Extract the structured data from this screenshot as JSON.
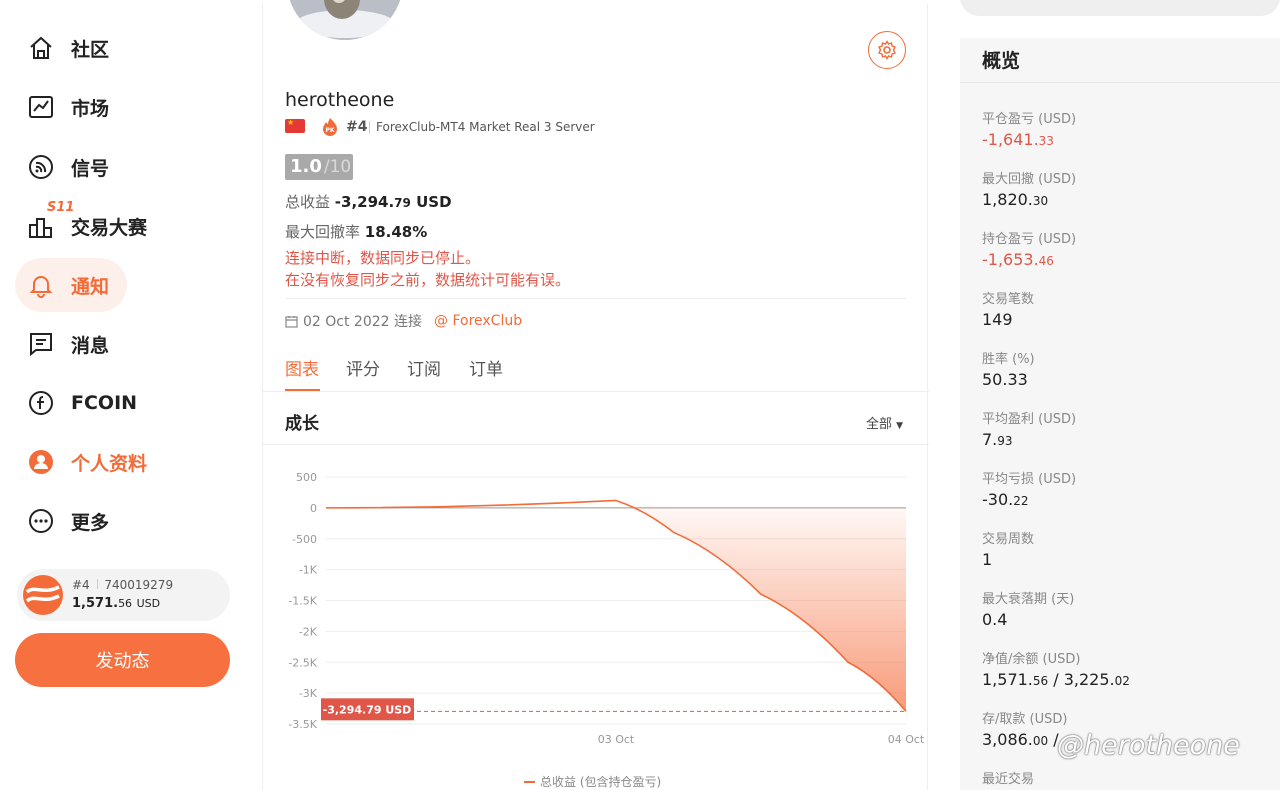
{
  "nav": {
    "items": [
      {
        "label": "社区"
      },
      {
        "label": "市场"
      },
      {
        "label": "信号"
      },
      {
        "label": "交易大赛",
        "badge": "S11"
      },
      {
        "label": "通知"
      },
      {
        "label": "消息"
      },
      {
        "label": "FCOIN"
      },
      {
        "label": "个人资料"
      },
      {
        "label": "更多"
      }
    ],
    "account": {
      "rank": "#4",
      "id": "740019279",
      "balance_int": "1,571.",
      "balance_dec": "56",
      "currency": "USD"
    },
    "post_label": "发动态"
  },
  "profile": {
    "username": "herotheone",
    "rank": "#4",
    "server": "ForexClub-MT4 Market Real 3 Server",
    "score": "1.0",
    "score_max": "/10",
    "total_profit_label": "总收益",
    "total_profit_int": "-3,294.",
    "total_profit_dec": "79",
    "total_profit_unit": "USD",
    "max_dd_label": "最大回撤率",
    "max_dd": "18.48%",
    "warning_line1": "连接中断，数据同步已停止。",
    "warning_line2": "在没有恢复同步之前，数据统计可能有误。",
    "connected_date": "02 Oct 2022 连接",
    "broker": "@ ForexClub"
  },
  "tabs": [
    "图表",
    "评分",
    "订阅",
    "订单"
  ],
  "growth": {
    "title": "成长",
    "filter": "全部"
  },
  "chart_data": {
    "type": "area",
    "ylim": [
      -3500,
      500
    ],
    "yticks": [
      "500",
      "0",
      "-500",
      "-1K",
      "-1.5K",
      "-2K",
      "-2.5K",
      "-3K",
      "-3.5K"
    ],
    "ytick_values": [
      500,
      0,
      -500,
      -1000,
      -1500,
      -2000,
      -2500,
      -3000,
      -3500
    ],
    "x_ticks": [
      "03 Oct",
      "04 Oct"
    ],
    "series": [
      {
        "name": "总收益 (包含持仓盈亏)",
        "x": [
          0,
          0.5,
          0.6,
          0.75,
          0.9,
          1.0
        ],
        "y": [
          0,
          120,
          -400,
          -1400,
          -2500,
          -3294.79
        ]
      }
    ],
    "current_label": "-3,294.79 USD",
    "current_value": -3294.79
  },
  "overview": {
    "title": "概览",
    "stats": [
      {
        "label": "平仓盈亏 (USD)",
        "int": "-1,641.",
        "dec": "33",
        "neg": true
      },
      {
        "label": "最大回撤 (USD)",
        "int": "1,820.",
        "dec": "30",
        "neg": false
      },
      {
        "label": "持仓盈亏 (USD)",
        "int": "-1,653.",
        "dec": "46",
        "neg": true
      },
      {
        "label": "交易笔数",
        "int": "149",
        "dec": "",
        "neg": false
      },
      {
        "label": "胜率 (%)",
        "int": "50.33",
        "dec": "",
        "neg": false
      },
      {
        "label": "平均盈利 (USD)",
        "int": "7.",
        "dec": "93",
        "neg": false
      },
      {
        "label": "平均亏损 (USD)",
        "int": "-30.",
        "dec": "22",
        "neg": false
      },
      {
        "label": "交易周数",
        "int": "1",
        "dec": "",
        "neg": false
      },
      {
        "label": "最大衰落期 (天)",
        "int": "0.4",
        "dec": "",
        "neg": false
      },
      {
        "label": "净值/余额 (USD)",
        "int": "1,571.",
        "dec": "56",
        "int2": " / 3,225.",
        "dec2": "02",
        "neg": false
      },
      {
        "label": "存/取款 (USD)",
        "int": "3,086.",
        "dec": "00",
        "int2": " / ",
        "dec2": "",
        "neg": false
      },
      {
        "label": "最近交易",
        "int": "",
        "dec": "",
        "neg": false
      }
    ]
  },
  "watermark": "@herotheone"
}
